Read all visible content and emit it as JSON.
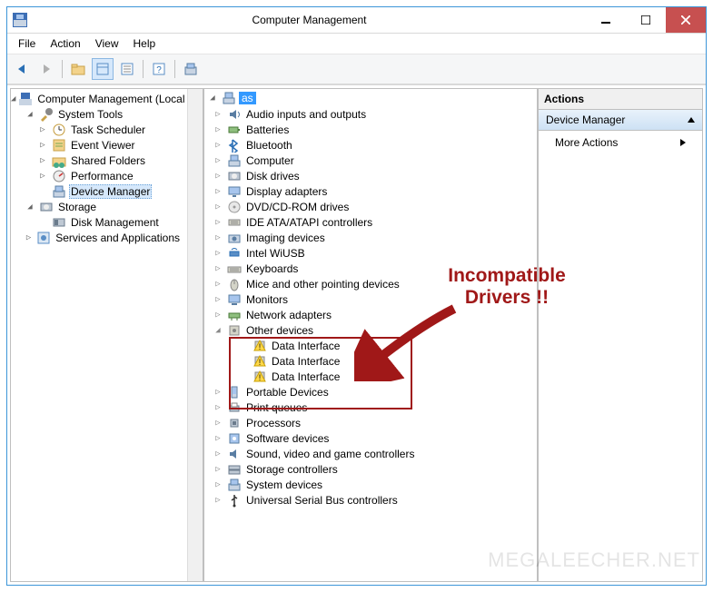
{
  "window": {
    "title": "Computer Management"
  },
  "menubar": [
    "File",
    "Action",
    "View",
    "Help"
  ],
  "left_tree": {
    "root": "Computer Management (Local",
    "system_tools": {
      "label": "System Tools",
      "items": [
        "Task Scheduler",
        "Event Viewer",
        "Shared Folders",
        "Performance",
        "Device Manager"
      ]
    },
    "storage": {
      "label": "Storage",
      "items": [
        "Disk Management"
      ]
    },
    "services": "Services and Applications"
  },
  "device_tree": {
    "root": "as",
    "categories": [
      {
        "label": "Audio inputs and outputs",
        "icon": "audio"
      },
      {
        "label": "Batteries",
        "icon": "battery"
      },
      {
        "label": "Bluetooth",
        "icon": "bluetooth"
      },
      {
        "label": "Computer",
        "icon": "computer"
      },
      {
        "label": "Disk drives",
        "icon": "disk"
      },
      {
        "label": "Display adapters",
        "icon": "display"
      },
      {
        "label": "DVD/CD-ROM drives",
        "icon": "cd"
      },
      {
        "label": "IDE ATA/ATAPI controllers",
        "icon": "ide"
      },
      {
        "label": "Imaging devices",
        "icon": "camera"
      },
      {
        "label": "Intel WiUSB",
        "icon": "wiusb"
      },
      {
        "label": "Keyboards",
        "icon": "keyboard"
      },
      {
        "label": "Mice and other pointing devices",
        "icon": "mouse"
      },
      {
        "label": "Monitors",
        "icon": "monitor"
      },
      {
        "label": "Network adapters",
        "icon": "net"
      },
      {
        "label": "Other devices",
        "icon": "other",
        "expanded": true,
        "children": [
          {
            "label": "Data Interface",
            "icon": "warn"
          },
          {
            "label": "Data Interface",
            "icon": "warn"
          },
          {
            "label": "Data Interface",
            "icon": "warn"
          }
        ]
      },
      {
        "label": "Portable Devices",
        "icon": "portable"
      },
      {
        "label": "Print queues",
        "icon": "printer"
      },
      {
        "label": "Processors",
        "icon": "cpu"
      },
      {
        "label": "Software devices",
        "icon": "software"
      },
      {
        "label": "Sound, video and game controllers",
        "icon": "sound"
      },
      {
        "label": "Storage controllers",
        "icon": "storagec"
      },
      {
        "label": "System devices",
        "icon": "system"
      },
      {
        "label": "Universal Serial Bus controllers",
        "icon": "usb"
      }
    ]
  },
  "actions": {
    "header": "Actions",
    "section": "Device Manager",
    "items": [
      "More Actions"
    ]
  },
  "annotation": {
    "line1": "Incompatible",
    "line2": "Drivers !!"
  },
  "watermark": "MEGALEECHER.NET"
}
